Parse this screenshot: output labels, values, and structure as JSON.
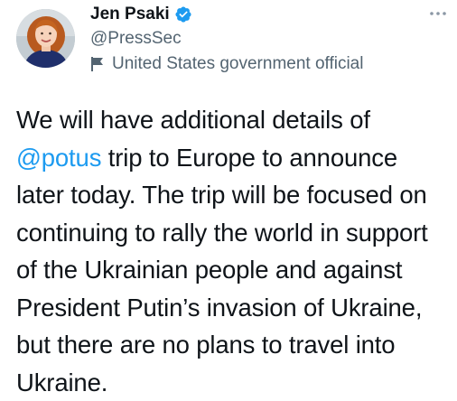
{
  "author": {
    "display_name": "Jen Psaki",
    "handle": "@PressSec",
    "label": "United States government official",
    "verified": true
  },
  "tweet": {
    "line1": "We will have additional details of",
    "line2_mention": "@potus",
    "line2_rest": " trip to Europe to announce",
    "line3": "later today. The trip will be focused on",
    "line4": "continuing to rally the world in support",
    "line5": "of the Ukrainian people and against",
    "line6": "President Putin’s invasion of Ukraine,",
    "line7": "but there are no plans to travel into",
    "line8": "Ukraine."
  },
  "icons": {
    "verified": "verified-badge-icon",
    "label": "flag-icon",
    "more": "more-options-icon"
  },
  "colors": {
    "accent": "#1d9bf0",
    "secondary_text": "#536471",
    "primary_text": "#0f1419"
  }
}
